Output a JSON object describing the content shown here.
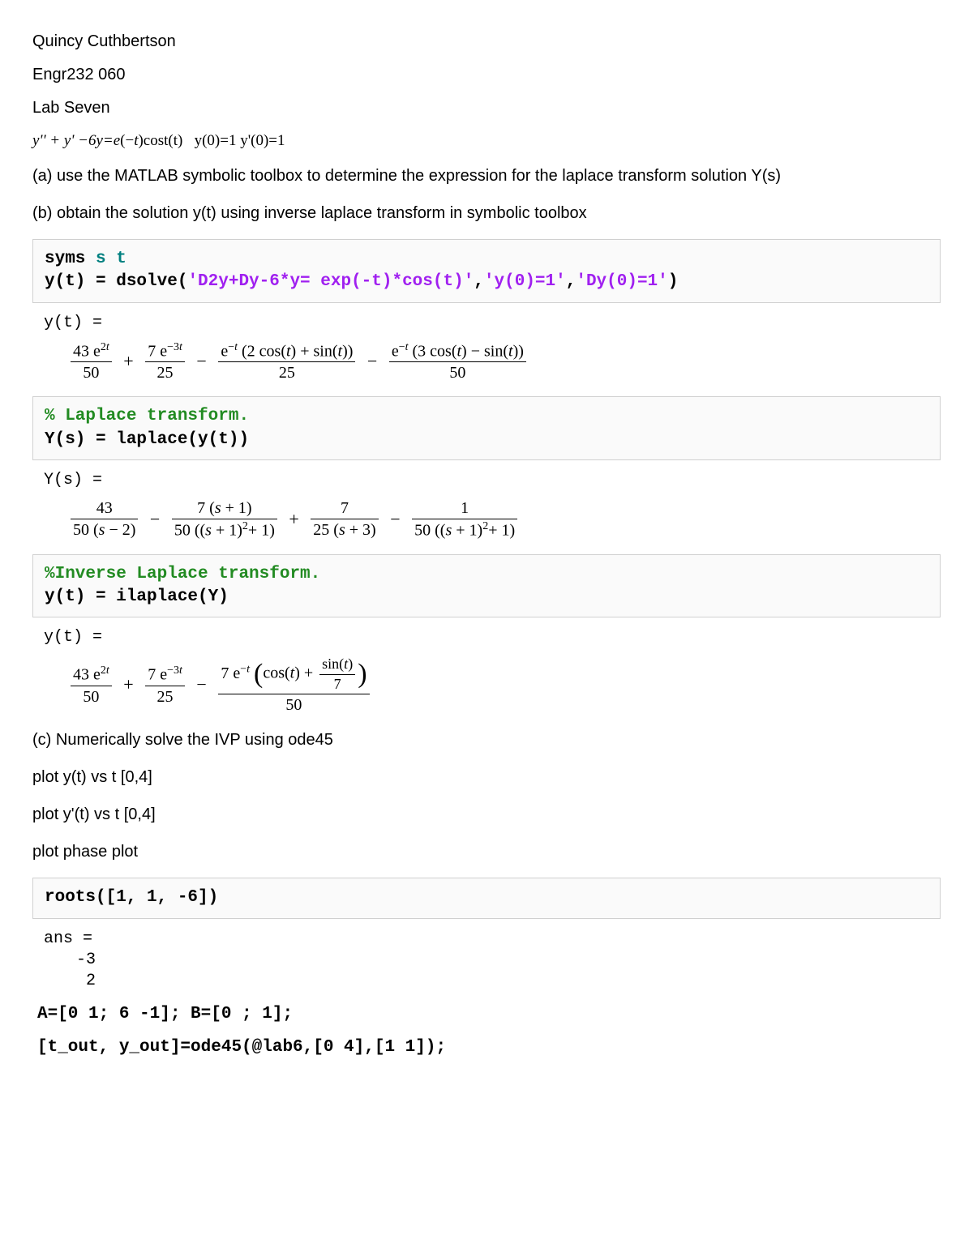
{
  "header": {
    "name": "Quincy Cuthbertson",
    "course": "Engr232 060",
    "lab": "Lab Seven"
  },
  "problem": {
    "equation_html": "<span class='italic'>y'' + y' −6y=e</span>(−<span class='italic'>t</span>)cost(t)&nbsp;&nbsp;&nbsp;y(0)=1 y'(0)=1",
    "part_a": "(a) use the MATLAB symbolic toolbox to determine the expression for the laplace transform solution Y(s)",
    "part_b": "(b) obtain the solution y(t) using inverse laplace transform in symbolic toolbox",
    "part_c": "(c) Numerically solve the IVP using ode45",
    "plot1": "plot y(t) vs t [0,4]",
    "plot2": "plot y'(t) vs t [0,4]",
    "plot3": "plot phase plot"
  },
  "code1": {
    "line1_a": "syms ",
    "line1_b": "s t",
    "line2_a": "y(t) = dsolve(",
    "line2_b": "'D2y+Dy-6*y= exp(-t)*cos(t)'",
    "line2_c": ",",
    "line2_d": "'y(0)=1'",
    "line2_e": ",",
    "line2_f": "'Dy(0)=1'",
    "line2_g": ")"
  },
  "out1": {
    "label": "y(t) =",
    "term1_num": "43 e<sup>2<i>t</i></sup>",
    "term1_den": "50",
    "term2_num": "7 e<sup>−3<i>t</i></sup>",
    "term2_den": "25",
    "term3_num": "e<sup>−<i>t</i></sup> (2 cos(<i>t</i>) + sin(<i>t</i>))",
    "term3_den": "25",
    "term4_num": "e<sup>−<i>t</i></sup> (3 cos(<i>t</i>) − sin(<i>t</i>))",
    "term4_den": "50"
  },
  "code2": {
    "comment": "% Laplace transform.",
    "line": "Y(s) = laplace(y(t))"
  },
  "out2": {
    "label": "Y(s) =",
    "t1_num": "43",
    "t1_den": "50 (<i>s</i> − 2)",
    "t2_num": "7 (<i>s</i> + 1)",
    "t2_den": "50 ((<i>s</i> + 1)<sup>2</sup>+ 1)",
    "t3_num": "7",
    "t3_den": "25 (<i>s</i> + 3)",
    "t4_num": "1",
    "t4_den": "50 ((<i>s</i> + 1)<sup>2</sup>+ 1)"
  },
  "code3": {
    "comment": "%Inverse Laplace transform.",
    "line": "y(t) = ilaplace(Y)"
  },
  "out3": {
    "label": "y(t) =",
    "t1_num": "43 e<sup>2<i>t</i></sup>",
    "t1_den": "50",
    "t2_num": "7 e<sup>−3<i>t</i></sup>",
    "t2_den": "25",
    "t3_num_outer": "7 e<sup>−<i>t</i></sup> ",
    "t3_inner_a": "cos(<i>t</i>) + ",
    "t3_inner_frac_num": "sin(<i>t</i>)",
    "t3_inner_frac_den": "7",
    "t3_den": "50"
  },
  "code4": {
    "line": "roots([1, 1, -6])"
  },
  "out4": {
    "label": "ans =",
    "v1": "-3",
    "v2": " 2"
  },
  "code5": {
    "line": "A=[0 1; 6 -1]; B=[0 ; 1];"
  },
  "code6": {
    "line": "[t_out, y_out]=ode45(@lab6,[0 4],[1 1]);"
  }
}
